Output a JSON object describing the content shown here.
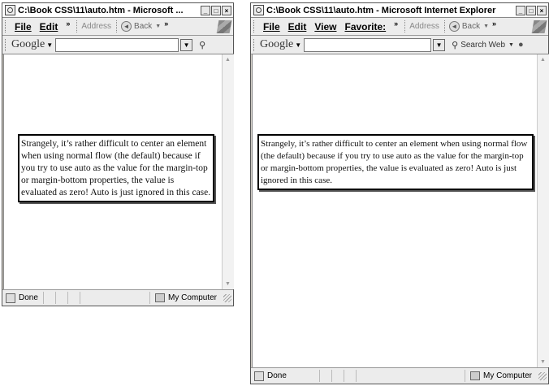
{
  "win1": {
    "title": "C:\\Book CSS\\11\\auto.htm - Microsoft ...",
    "menu": {
      "file": "File",
      "edit": "Edit",
      "chevron": "»",
      "address": "Address",
      "back": "Back",
      "chevron2": "»"
    },
    "google": {
      "logo": "Google",
      "search_label": ""
    },
    "paragraph": "Strangely, it’s rather difficult to center an element when using normal flow (the default) because if you try to use auto as the value for the margin-top or margin-bottom properties, the value is evaluated as zero! Auto is just ignored in this case.",
    "status": {
      "text": "Done",
      "zone": "My Computer"
    }
  },
  "win2": {
    "title": "C:\\Book CSS\\11\\auto.htm - Microsoft Internet Explorer",
    "menu": {
      "file": "File",
      "edit": "Edit",
      "view": "View",
      "favorites": "Favorite:",
      "chevron": "»",
      "address": "Address",
      "back": "Back",
      "chevron2": "»"
    },
    "google": {
      "logo": "Google",
      "search_label": "Search Web"
    },
    "paragraph": "Strangely, it’s rather difficult to center an element when using normal flow (the default) because if you try to use auto as the value for the margin-top or margin-bottom properties, the value is evaluated as zero! Auto is just ignored in this case.",
    "status": {
      "text": "Done",
      "zone": "My Computer"
    }
  }
}
